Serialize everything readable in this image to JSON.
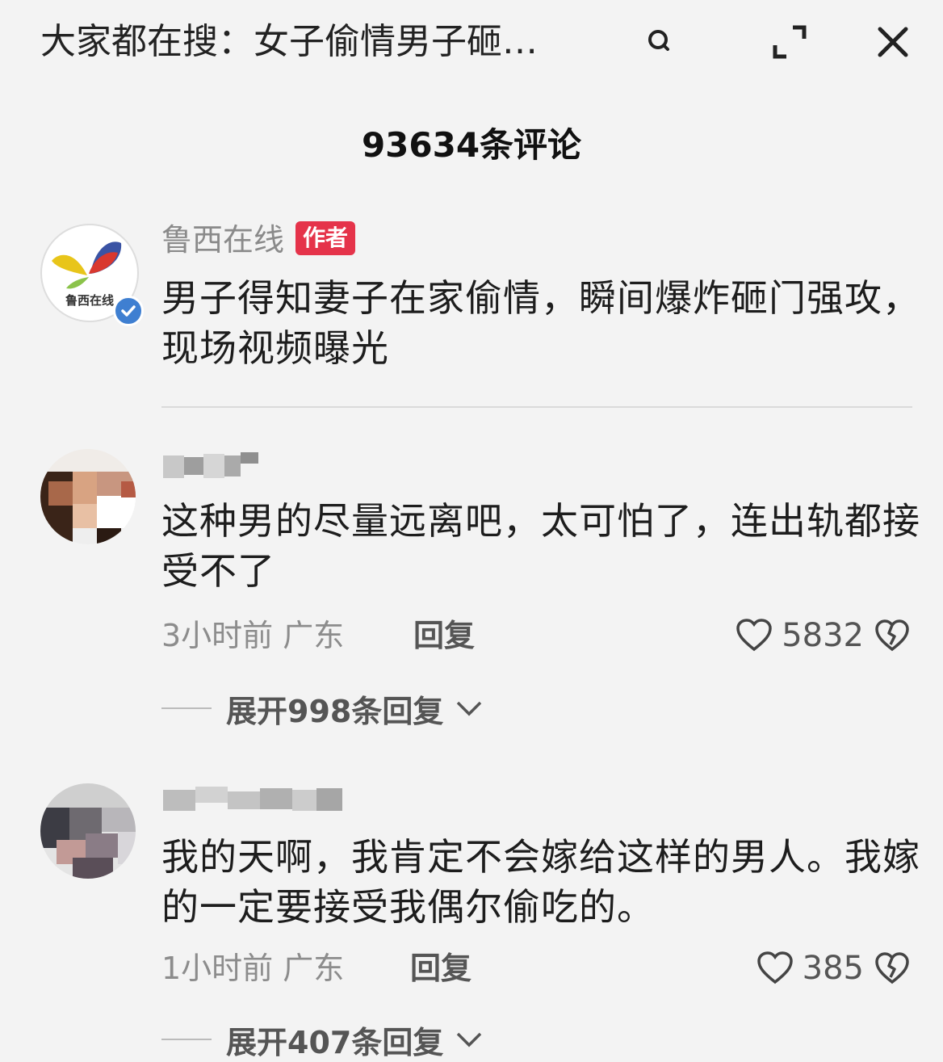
{
  "topbar": {
    "search_query": "大家都在搜：女子偷情男子砸…",
    "icons": [
      "search-icon",
      "expand-icon",
      "close-icon"
    ]
  },
  "comments_title": "93634条评论",
  "post": {
    "author_name": "鲁西在线",
    "author_badge": "作者",
    "avatar_text": "鲁西在线",
    "text": "男子得知妻子在家偷情，瞬间爆炸砸门强攻，现场视频曝光"
  },
  "comments": [
    {
      "text": "这种男的尽量远离吧，太可怕了，连出轨都接受不了",
      "time": "3小时前",
      "location": "广东",
      "reply_label": "回复",
      "likes": "5832",
      "expand_label": "展开998条回复"
    },
    {
      "text": "我的天啊，我肯定不会嫁给这样的男人。我嫁的一定要接受我偶尔偷吃的。",
      "time": "1小时前",
      "location": "广东",
      "reply_label": "回复",
      "likes": "385",
      "expand_label": "展开407条回复"
    }
  ],
  "colors": {
    "background": "#f3f3f3",
    "author_badge": "#e5334a",
    "verified": "#3f7fd1"
  }
}
